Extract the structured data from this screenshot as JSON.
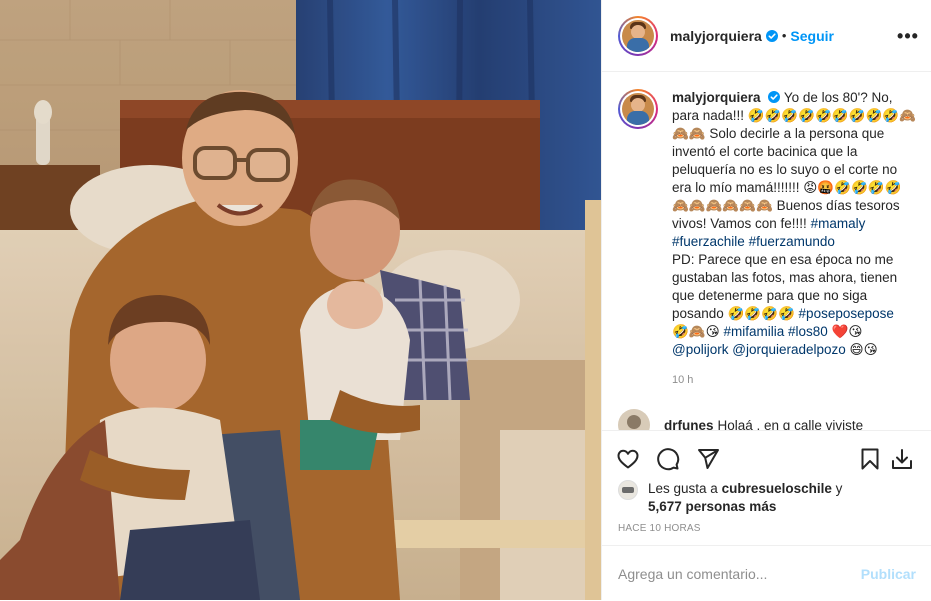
{
  "post": {
    "author": "malyjorquiera",
    "follow_label": "Seguir",
    "separator": "•",
    "more_label": "•••"
  },
  "caption": {
    "author": "malyjorquiera",
    "text_1": "Yo de los 80'? No, para nada!!! 🤣🤣🤣🤣🤣🤣🤣🤣🤣🙈🙈🙈 Solo decirle a la persona que inventó el corte bacinica que la peluquería no es lo suyo o el corte no era lo mío mamá!!!!!!! 😡🤬🤣🤣🤣🤣🙈🙈🙈🙈🙈🙈 Buenos días tesoros vivos! Vamos con fe!!!! ",
    "tags_1": [
      "#mamaly",
      "#fuerzachile",
      "#fuerzamundo"
    ],
    "text_2": "PD: Parece que en esa época no me gustaban las fotos, mas ahora, tienen que detenerme para que no siga posando 🤣🤣🤣🤣 ",
    "tags_2": [
      "#poseposepose"
    ],
    "text_3": "🤣🙈😘 ",
    "tags_3": [
      "#mifamilia",
      "#los80"
    ],
    "text_4": " ❤️😘 ",
    "mentions": [
      "@polijork",
      "@jorquieradelpozo"
    ],
    "text_5": " 😄😘",
    "time": "10 h"
  },
  "comment": {
    "author": "drfunes",
    "text": "Holaá , en q calle viviste"
  },
  "actions": {
    "like_icon": "heart-icon",
    "comment_icon": "comment-icon",
    "share_icon": "paper-plane-icon",
    "save_icon": "bookmark-icon",
    "download_icon": "download-icon"
  },
  "likes": {
    "prefix": "Les gusta a",
    "user": "cubresueloschile",
    "connector": "y",
    "count": "5,677 personas más"
  },
  "timestamp": "HACE 10 HORAS",
  "add_comment": {
    "placeholder": "Agrega un comentario...",
    "publish_label": "Publicar"
  },
  "colors": {
    "link_blue": "#0095f6",
    "tag_blue": "#00376b",
    "muted": "#8e8e8e",
    "publish_disabled": "#b2dffc"
  }
}
